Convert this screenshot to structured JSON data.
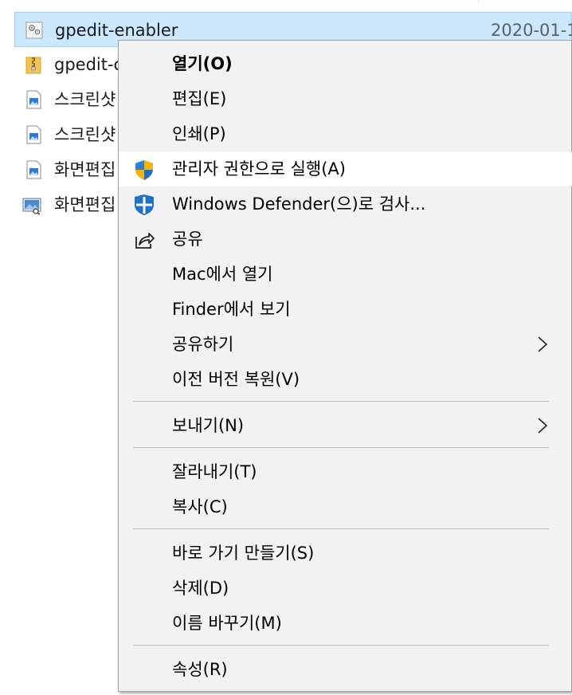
{
  "files": [
    {
      "name": "gpedit-enabler",
      "date": "2020-01-1",
      "icon": "script-icon",
      "selected": true
    },
    {
      "name": "gpedit-c",
      "date": "",
      "icon": "zip-folder-icon",
      "selected": false
    },
    {
      "name": "스크린샷",
      "date": "",
      "icon": "image-icon",
      "selected": false
    },
    {
      "name": "스크린샷",
      "date": "",
      "icon": "image-icon",
      "selected": false
    },
    {
      "name": "화면편집",
      "date": "",
      "icon": "image-icon",
      "selected": false
    },
    {
      "name": "화면편집",
      "date": "",
      "icon": "photo-viewer-icon",
      "selected": false
    }
  ],
  "context_menu": {
    "open": "열기(O)",
    "edit": "편집(E)",
    "print": "인쇄(P)",
    "run_as_admin": "관리자 권한으로 실행(A)",
    "defender_scan": "Windows Defender(으)로 검사...",
    "share": "공유",
    "open_in_mac": "Mac에서 열기",
    "show_in_finder": "Finder에서 보기",
    "share_with": "공유하기",
    "restore_versions": "이전 버전 복원(V)",
    "send_to": "보내기(N)",
    "cut": "잘라내기(T)",
    "copy": "복사(C)",
    "create_shortcut": "바로 가기 만들기(S)",
    "delete": "삭제(D)",
    "rename": "이름 바꾸기(M)",
    "properties": "속성(R)"
  },
  "colors": {
    "selection_bg": "#cce8ff",
    "menu_bg": "#f2f2f2",
    "shield_blue": "#1f6fc5",
    "shield_yellow": "#f7b500"
  }
}
